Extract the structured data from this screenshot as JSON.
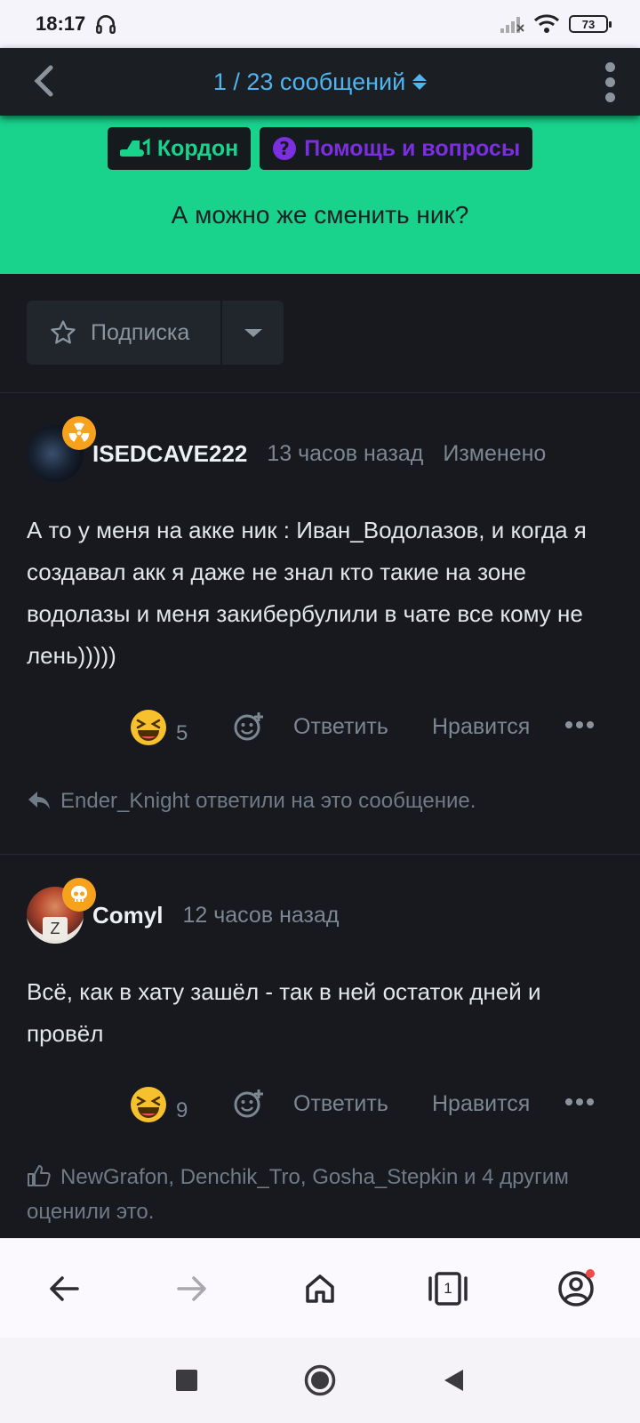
{
  "status_bar": {
    "time": "18:17",
    "battery": "73"
  },
  "nav": {
    "title": "1 / 23 сообщений"
  },
  "thread": {
    "tags": [
      {
        "label": "Кордон",
        "color": "#19d38d"
      },
      {
        "label": "Помощь и вопросы",
        "color": "#7b2fe0"
      }
    ],
    "title": "А можно же сменить ник?"
  },
  "subscribe": {
    "label": "Подписка"
  },
  "posts": [
    {
      "username": "ISEDCAVE222",
      "time": "13 часов назад",
      "edited": "Изменено",
      "badge_icon": "radiation-icon",
      "body": "А то у меня на акке ник : Иван_Водолазов, и когда я создавал акк я даже не знал кто такие на зоне водолазы и меня закибербулили в чате все кому не лень)))))",
      "reaction_count": "5",
      "reply_label": "Ответить",
      "like_label": "Нравится",
      "footnote": "Ender_Knight ответили на это сообщение."
    },
    {
      "username": "Comyl",
      "time": "12 часов назад",
      "badge_icon": "skull-icon",
      "body": "Всё, как в хату зашёл - так в ней остаток дней и провёл",
      "reaction_count": "9",
      "reply_label": "Ответить",
      "like_label": "Нравится",
      "footnote": "NewGrafon, Denchik_Tro, Gosha_Stepkin и 4 другим оценили это."
    }
  ],
  "browser_bar": {
    "tab_count": "1"
  },
  "colors": {
    "accent": "#19d38d",
    "link": "#4fb4ef",
    "background": "#17191e"
  }
}
